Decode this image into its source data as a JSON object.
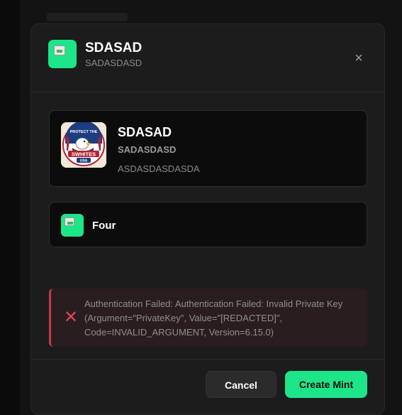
{
  "modal": {
    "title": "SDASAD",
    "subtitle": "SADASDASD",
    "close_icon": "close-icon"
  },
  "token": {
    "name": "SDASAD",
    "symbol": "SADASDASD",
    "description": "ASDASDASDASDA",
    "image_text_top": "PROTECT THE",
    "image_text_mid": "SWHITES",
    "image_text_bottom": "USA"
  },
  "platform": {
    "label": "Four"
  },
  "error": {
    "message": "Authentication Failed: Authentication Failed: Invalid Private Key (Argument=\"PrivateKey\", Value=\"[REDACTED]\", Code=INVALID_ARGUMENT, Version=6.15.0)"
  },
  "footer": {
    "cancel_label": "Cancel",
    "create_label": "Create Mint"
  },
  "colors": {
    "accent": "#1de58a",
    "error": "#e0445a",
    "background": "#1c1c1c"
  }
}
